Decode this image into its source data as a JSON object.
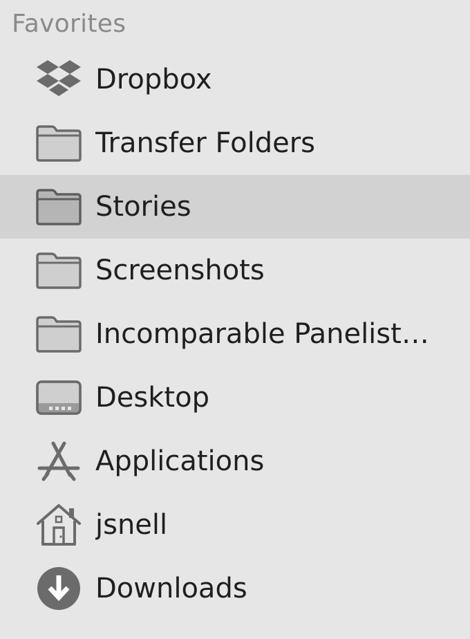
{
  "sidebar": {
    "section_title": "Favorites",
    "items": [
      {
        "label": "Dropbox",
        "icon": "dropbox-icon"
      },
      {
        "label": "Transfer Folders",
        "icon": "folder-icon"
      },
      {
        "label": "Stories",
        "icon": "folder-icon",
        "selected": true
      },
      {
        "label": "Screenshots",
        "icon": "folder-icon"
      },
      {
        "label": "Incomparable Panelist…",
        "icon": "folder-icon"
      },
      {
        "label": "Desktop",
        "icon": "desktop-icon"
      },
      {
        "label": "Applications",
        "icon": "applications-icon"
      },
      {
        "label": "jsnell",
        "icon": "home-icon"
      },
      {
        "label": "Downloads",
        "icon": "downloads-icon"
      }
    ]
  },
  "colors": {
    "background": "#e6e6e6",
    "selected_row": "#d2d2d2",
    "section_title": "#8a8a8a",
    "label": "#1f1f1f",
    "icon": "#6b6b6b"
  }
}
